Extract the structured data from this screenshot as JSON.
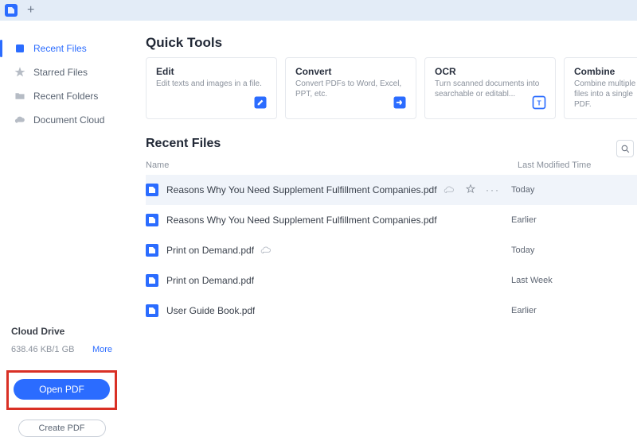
{
  "tabbar": {
    "plus": "+"
  },
  "sidebar": {
    "items": [
      {
        "label": "Recent Files",
        "icon": "recent",
        "active": true
      },
      {
        "label": "Starred Files",
        "icon": "star",
        "active": false
      },
      {
        "label": "Recent Folders",
        "icon": "folder",
        "active": false
      },
      {
        "label": "Document Cloud",
        "icon": "cloud",
        "active": false
      }
    ],
    "cloud": {
      "title": "Cloud Drive",
      "usage": "638.46 KB/1 GB",
      "more": "More"
    },
    "open_label": "Open PDF",
    "create_label": "Create PDF"
  },
  "quick_tools": {
    "title": "Quick Tools",
    "cards": [
      {
        "title": "Edit",
        "desc": "Edit texts and images in a file.",
        "icon": "edit"
      },
      {
        "title": "Convert",
        "desc": "Convert PDFs to Word, Excel, PPT, etc.",
        "icon": "convert"
      },
      {
        "title": "OCR",
        "desc": "Turn scanned documents into searchable or editabl...",
        "icon": "ocr"
      },
      {
        "title": "Combine",
        "desc": "Combine multiple files into a single PDF.",
        "icon": "combine"
      }
    ]
  },
  "recent": {
    "title": "Recent Files",
    "columns": {
      "name": "Name",
      "modified": "Last Modified Time"
    },
    "rows": [
      {
        "name": "Reasons Why You Need Supplement Fulfillment Companies.pdf",
        "modified": "Today",
        "selected": true,
        "cloud": true,
        "show_actions": true
      },
      {
        "name": "Reasons Why You Need Supplement Fulfillment Companies.pdf",
        "modified": "Earlier",
        "selected": false,
        "cloud": false,
        "show_actions": false
      },
      {
        "name": "Print on Demand.pdf",
        "modified": "Today",
        "selected": false,
        "cloud": true,
        "show_actions": false
      },
      {
        "name": "Print on Demand.pdf",
        "modified": "Last Week",
        "selected": false,
        "cloud": false,
        "show_actions": false
      },
      {
        "name": "User Guide Book.pdf",
        "modified": "Earlier",
        "selected": false,
        "cloud": false,
        "show_actions": false
      }
    ]
  }
}
